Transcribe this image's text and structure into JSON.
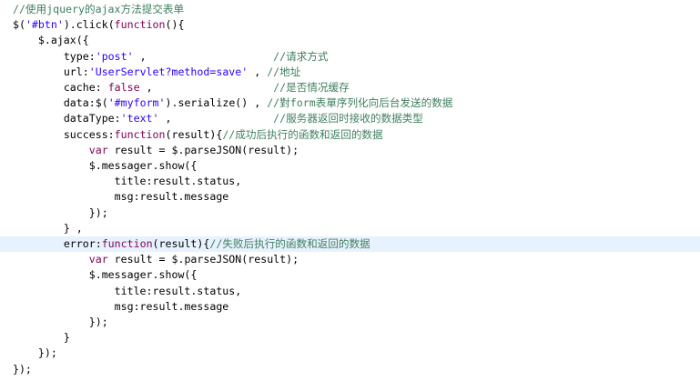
{
  "editor": {
    "language": "javascript",
    "colors": {
      "background": "#ffffff",
      "current_line": "#e8f2fe",
      "plain": "#000000",
      "comment": "#3f7f5f",
      "keyword": "#7f0055",
      "string": "#2a00ff"
    },
    "highlighted_line_index": 15,
    "lines": [
      {
        "indent": 2,
        "tokens": [
          {
            "t": "comment",
            "v": "//使用jquery的ajax方法提交表单"
          }
        ]
      },
      {
        "indent": 2,
        "tokens": [
          {
            "t": "plain",
            "v": "$("
          },
          {
            "t": "string",
            "v": "'#btn'"
          },
          {
            "t": "plain",
            "v": ").click("
          },
          {
            "t": "keyword",
            "v": "function"
          },
          {
            "t": "plain",
            "v": "(){"
          }
        ]
      },
      {
        "indent": 6,
        "tokens": [
          {
            "t": "plain",
            "v": "$.ajax({"
          }
        ]
      },
      {
        "indent": 10,
        "tokens": [
          {
            "t": "plain",
            "v": "type:"
          },
          {
            "t": "string",
            "v": "'post'"
          },
          {
            "t": "plain",
            "v": " ,                    "
          },
          {
            "t": "comment",
            "v": "//请求方式"
          }
        ]
      },
      {
        "indent": 10,
        "tokens": [
          {
            "t": "plain",
            "v": "url:"
          },
          {
            "t": "string",
            "v": "'UserServlet?method=save'"
          },
          {
            "t": "plain",
            "v": " , "
          },
          {
            "t": "comment",
            "v": "//地址"
          }
        ]
      },
      {
        "indent": 10,
        "tokens": [
          {
            "t": "plain",
            "v": "cache: "
          },
          {
            "t": "keyword",
            "v": "false"
          },
          {
            "t": "plain",
            "v": " ,                   "
          },
          {
            "t": "comment",
            "v": "//是否情况缓存"
          }
        ]
      },
      {
        "indent": 10,
        "tokens": [
          {
            "t": "plain",
            "v": "data:$("
          },
          {
            "t": "string",
            "v": "'#myform'"
          },
          {
            "t": "plain",
            "v": ").serialize() , "
          },
          {
            "t": "comment",
            "v": "//對form表單序列化向后台发送的数据"
          }
        ]
      },
      {
        "indent": 10,
        "tokens": [
          {
            "t": "plain",
            "v": "dataType:"
          },
          {
            "t": "string",
            "v": "'text'"
          },
          {
            "t": "plain",
            "v": " ,                "
          },
          {
            "t": "comment",
            "v": "//服务器返回时接收的数据类型"
          }
        ]
      },
      {
        "indent": 10,
        "tokens": [
          {
            "t": "plain",
            "v": "success:"
          },
          {
            "t": "keyword",
            "v": "function"
          },
          {
            "t": "plain",
            "v": "(result){"
          },
          {
            "t": "comment",
            "v": "//成功后执行的函数和返回的数据"
          }
        ]
      },
      {
        "indent": 14,
        "tokens": [
          {
            "t": "keyword",
            "v": "var"
          },
          {
            "t": "plain",
            "v": " result = $.parseJSON(result);"
          }
        ]
      },
      {
        "indent": 14,
        "tokens": [
          {
            "t": "plain",
            "v": "$.messager.show({"
          }
        ]
      },
      {
        "indent": 18,
        "tokens": [
          {
            "t": "plain",
            "v": "title:result.status,"
          }
        ]
      },
      {
        "indent": 18,
        "tokens": [
          {
            "t": "plain",
            "v": "msg:result.message"
          }
        ]
      },
      {
        "indent": 14,
        "tokens": [
          {
            "t": "plain",
            "v": "});"
          }
        ]
      },
      {
        "indent": 10,
        "tokens": [
          {
            "t": "plain",
            "v": "} ,"
          }
        ]
      },
      {
        "indent": 10,
        "tokens": [
          {
            "t": "plain",
            "v": "error:"
          },
          {
            "t": "keyword",
            "v": "function"
          },
          {
            "t": "plain",
            "v": "(result){"
          },
          {
            "t": "comment",
            "v": "//失败后执行的函数和返回的数据"
          }
        ]
      },
      {
        "indent": 14,
        "tokens": [
          {
            "t": "keyword",
            "v": "var"
          },
          {
            "t": "plain",
            "v": " result = $.parseJSON(result);"
          }
        ]
      },
      {
        "indent": 14,
        "tokens": [
          {
            "t": "plain",
            "v": "$.messager.show({"
          }
        ]
      },
      {
        "indent": 18,
        "tokens": [
          {
            "t": "plain",
            "v": "title:result.status,"
          }
        ]
      },
      {
        "indent": 18,
        "tokens": [
          {
            "t": "plain",
            "v": "msg:result.message"
          }
        ]
      },
      {
        "indent": 14,
        "tokens": [
          {
            "t": "plain",
            "v": "});"
          }
        ]
      },
      {
        "indent": 10,
        "tokens": [
          {
            "t": "plain",
            "v": "}"
          }
        ]
      },
      {
        "indent": 6,
        "tokens": [
          {
            "t": "plain",
            "v": "});"
          }
        ]
      },
      {
        "indent": 2,
        "tokens": [
          {
            "t": "plain",
            "v": "});"
          }
        ]
      }
    ]
  }
}
